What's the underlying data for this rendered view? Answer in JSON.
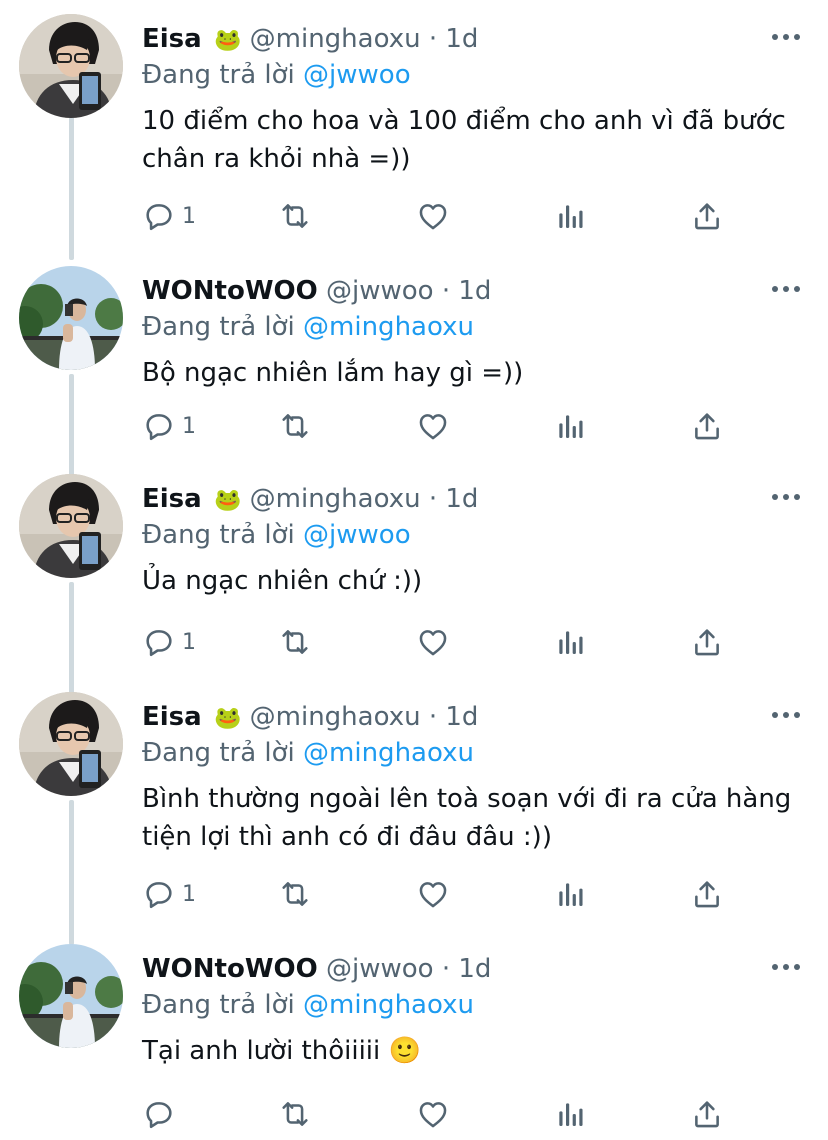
{
  "tweets": [
    {
      "name": "Eisa",
      "name_emoji": "🐸",
      "handle": "@minghaoxu",
      "dot": "·",
      "time": "1d",
      "replying_prefix": "Đang trả lời",
      "replying_to": "@jwwoo",
      "text_lines": [
        "10 điểm cho hoa và 100 điểm cho anh vì đã bước",
        "chân ra khỏi nhà =))"
      ],
      "reply_count": "1"
    },
    {
      "name": "WONtoWOO",
      "name_emoji": "",
      "handle": "@jwwoo",
      "dot": "·",
      "time": "1d",
      "replying_prefix": "Đang trả lời",
      "replying_to": "@minghaoxu",
      "text_lines": [
        "Bộ ngạc nhiên lắm hay gì =))"
      ],
      "reply_count": "1"
    },
    {
      "name": "Eisa",
      "name_emoji": "🐸",
      "handle": "@minghaoxu",
      "dot": "·",
      "time": "1d",
      "replying_prefix": "Đang trả lời",
      "replying_to": "@jwwoo",
      "text_lines": [
        "Ủa ngạc nhiên chứ :))"
      ],
      "reply_count": "1"
    },
    {
      "name": "Eisa",
      "name_emoji": "🐸",
      "handle": "@minghaoxu",
      "dot": "·",
      "time": "1d",
      "replying_prefix": "Đang trả lời",
      "replying_to": "@minghaoxu",
      "text_lines": [
        "Bình thường ngoài lên toà soạn với đi ra cửa hàng",
        "tiện lợi thì anh có đi đâu đâu :))"
      ],
      "reply_count": "1"
    },
    {
      "name": "WONtoWOO",
      "name_emoji": "",
      "handle": "@jwwoo",
      "dot": "·",
      "time": "1d",
      "replying_prefix": "Đang trả lời",
      "replying_to": "@minghaoxu",
      "text_lines": [
        "Tại anh lười thôiiiii 🙂"
      ],
      "reply_count": ""
    }
  ],
  "icons": {
    "reply": "reply-icon",
    "retweet": "retweet-icon",
    "like": "heart-icon",
    "views": "analytics-icon",
    "share": "share-icon",
    "more": "more-icon"
  },
  "colors": {
    "link": "#1d9bf0",
    "muted": "#536471",
    "text": "#0f1419",
    "thread_line": "#cfd9de"
  }
}
